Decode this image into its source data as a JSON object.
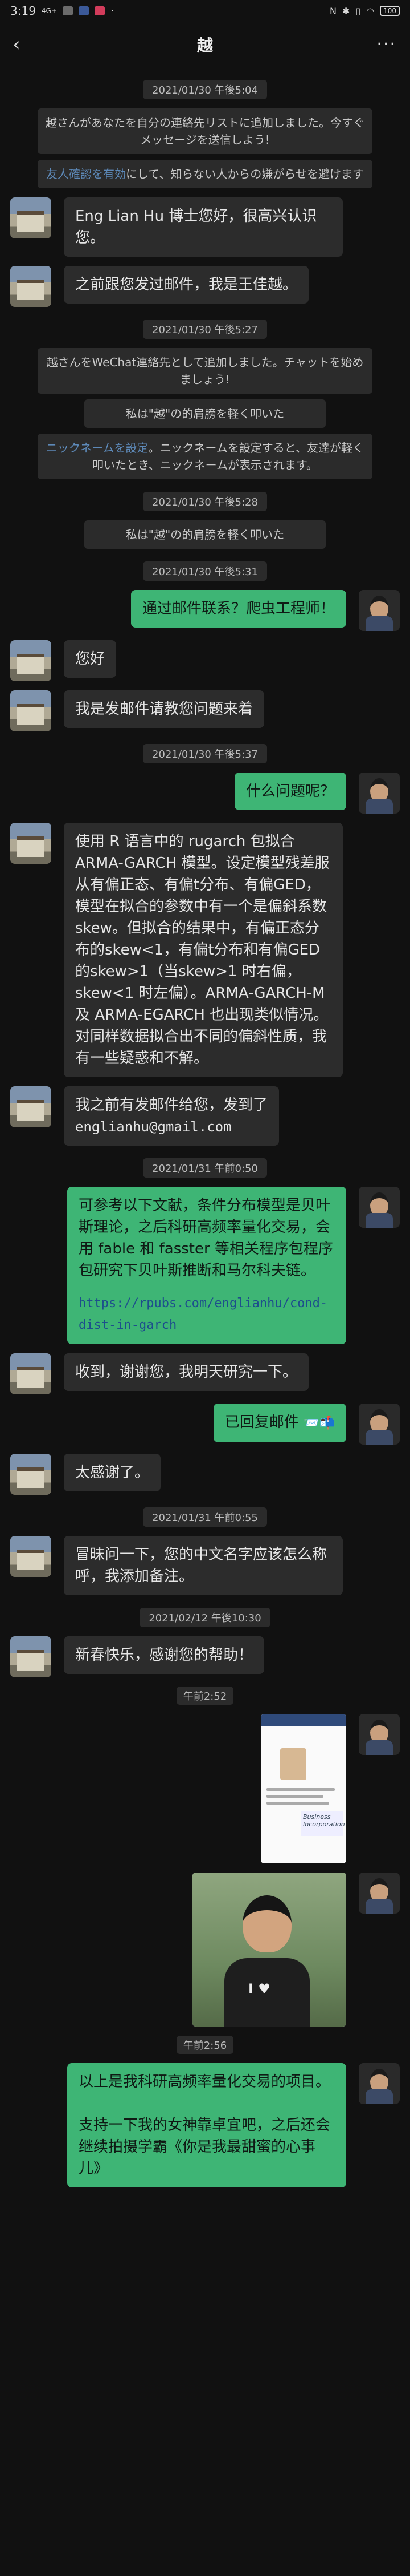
{
  "status": {
    "time": "3:19",
    "signal": "4G+",
    "battery": "100"
  },
  "header": {
    "title": "越"
  },
  "messages": {
    "t1": "2021/01/30 午後5:04",
    "sys1": "越さんがあなたを自分の連絡先リストに追加しました。今すぐメッセージを送信しよう!",
    "sys2_hl": "友人確認を有効",
    "sys2_rest": "にして、知らない人からの嫌がらせを避けます",
    "m1": "Eng Lian Hu 博士您好，很高兴认识您。",
    "m2": "之前跟您发过邮件，我是王佳越。",
    "t2": "2021/01/30 午後5:27",
    "sys3": "越さんをWeChat連絡先として追加しました。チャットを始めましょう!",
    "sys4": "私は\"越\"の的肩膀を軽く叩いた",
    "sys5_hl": "ニックネームを設定",
    "sys5_rest": "。ニックネームを設定すると、友達が軽く叩いたとき、ニックネームが表示されます。",
    "t3": "2021/01/30 午後5:28",
    "sys6": "私は\"越\"の的肩膀を軽く叩いた",
    "t4": "2021/01/30 午後5:31",
    "m3": "通过邮件联系？爬虫工程师！",
    "m4": "您好",
    "m5": "我是发邮件请教您问题来着",
    "t5": "2021/01/30 午後5:37",
    "m6": "什么问题呢？",
    "m7": "使用 R 语言中的 rugarch 包拟合 ARMA-GARCH 模型。设定模型残差服从有偏正态、有偏t分布、有偏GED，模型在拟合的参数中有一个是偏斜系数 skew。但拟合的结果中，有偏正态分布的skew<1，有偏t分布和有偏GED的skew>1（当skew>1 时右偏，skew<1 时左偏）。ARMA-GARCH-M 及 ARMA-EGARCH 也出现类似情况。对同样数据拟合出不同的偏斜性质，我有一些疑惑和不解。",
    "m8_text": "我之前有发邮件给您，发到了",
    "m8_mail": "englianhu@gmail.com",
    "t6": "2021/01/31 午前0:50",
    "m9_text": "可参考以下文献，条件分布模型是贝叶斯理论，之后科研高频率量化交易，会用 fable 和 fasster 等相关程序包程序包研究下贝叶斯推断和马尔科夫链。",
    "m9_link": "https://rpubs.com/englianhu/cond-dist-in-garch",
    "m10": "收到，谢谢您，我明天研究一下。",
    "m11": "已回复邮件",
    "m11_emoji": "📨📬",
    "m12": "太感谢了。",
    "t7": "2021/01/31 午前0:55",
    "m13": "冒昧问一下，您的中文名字应该怎么称呼，我添加备注。",
    "t8": "2021/02/12 午後10:30",
    "m14": "新春快乐，感谢您的帮助！",
    "t9": "午前2:52",
    "img_banner": "Business Incorporation",
    "t10": "午前2:56",
    "m15a": "以上是我科研高频率量化交易的项目。",
    "m15b": "支持一下我的女神靠卓宜吧，之后还会继续拍摄学霸《你是我最甜蜜的心事儿》"
  }
}
